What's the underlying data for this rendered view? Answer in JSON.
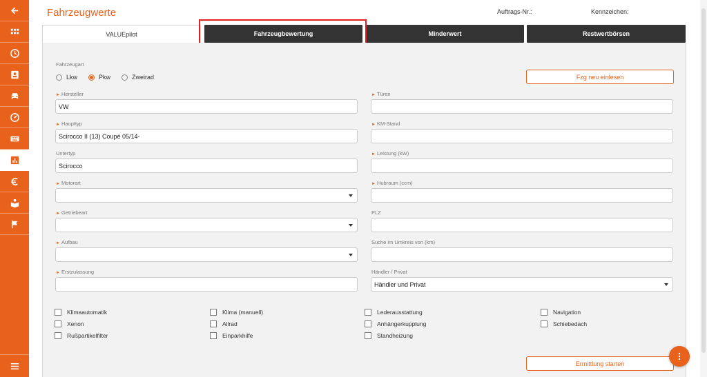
{
  "header": {
    "title": "Fahrzeugwerte",
    "auftrags_label": "Auftrags-Nr.:",
    "kennzeichen_label": "Kennzeichen:"
  },
  "tabs": [
    {
      "label": "VALUEpilot"
    },
    {
      "label": "Fahrzeugbewertung"
    },
    {
      "label": "Minderwert"
    },
    {
      "label": "Restwertbörsen"
    }
  ],
  "sidebar": {
    "items": [
      {
        "icon": "back-arrow-icon"
      },
      {
        "icon": "grid-icon"
      },
      {
        "icon": "clock-icon"
      },
      {
        "icon": "contact-card-icon"
      },
      {
        "icon": "car-icon"
      },
      {
        "icon": "speedometer-icon"
      },
      {
        "icon": "keyboard-icon"
      },
      {
        "icon": "bar-chart-icon",
        "active": true
      },
      {
        "icon": "euro-icon"
      },
      {
        "icon": "reader-icon"
      },
      {
        "icon": "flag-icon"
      }
    ],
    "menu_icon": "hamburger-menu-icon"
  },
  "form": {
    "fahrzeugart_label": "Fahrzeugart",
    "radio_options": [
      "Lkw",
      "Pkw",
      "Zweirad"
    ],
    "selected_option": "Pkw",
    "reload_button": "Fzg neu einlesen",
    "left": [
      {
        "label": "Hersteller",
        "value": "VW",
        "required": true
      },
      {
        "label": "Haupttyp",
        "value": "Scirocco II (13) Coupé 05/14-",
        "required": true
      },
      {
        "label": "Untertyp",
        "value": "Scirocco",
        "required": false
      },
      {
        "label": "Motorart",
        "value": "",
        "required": true,
        "select": true
      },
      {
        "label": "Getriebeart",
        "value": "",
        "required": true,
        "select": true
      },
      {
        "label": "Aufbau",
        "value": "",
        "required": true,
        "select": true
      },
      {
        "label": "Erstzulassung",
        "value": "",
        "required": true
      }
    ],
    "right": [
      {
        "label": "Türen",
        "value": "",
        "required": true
      },
      {
        "label": "KM-Stand",
        "value": "",
        "required": true
      },
      {
        "label": "Leistung (kW)",
        "value": "",
        "required": true
      },
      {
        "label": "Hubraum (ccm)",
        "value": "",
        "required": true
      },
      {
        "label": "PLZ",
        "value": "",
        "required": false
      },
      {
        "label": "Suche im Umkreis von (km)",
        "value": "",
        "required": false
      },
      {
        "label": "Händler / Privat",
        "value": "Händler und Privat",
        "required": false,
        "select": true
      }
    ],
    "checkboxes": [
      [
        "Klimaautomatik",
        "Xenon",
        "Rußpartikelfilter"
      ],
      [
        "Klima (manuell)",
        "Allrad",
        "Einparkhilfe"
      ],
      [
        "Lederausstattung",
        "Anhängerkupplung",
        "Standheizung"
      ],
      [
        "Navigation",
        "Schiebedach"
      ]
    ],
    "start_button": "Ermittlung starten"
  },
  "colors": {
    "accent": "#e8621c",
    "tab_dark": "#333333",
    "highlight": "#e02020"
  }
}
